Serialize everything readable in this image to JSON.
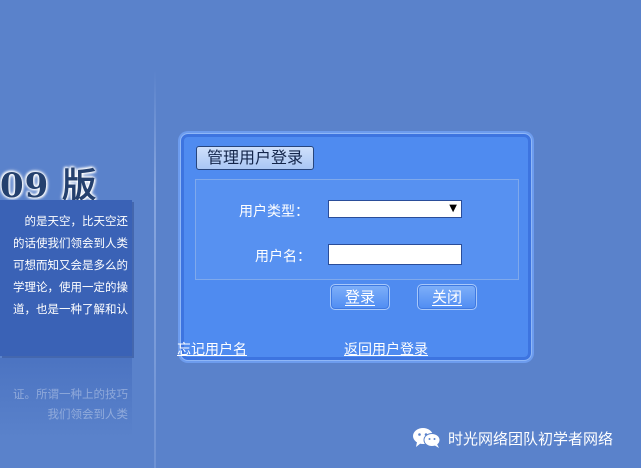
{
  "intro": {
    "version_text": "09 版",
    "lines": [
      "的是天空，比天空还",
      "的话使我们领会到人类",
      "可想而知又会是多么的",
      "学理论，使用一定的操",
      "道，也是一种了解和认"
    ],
    "reflection_lines": [
      "证。所谓一种上的技巧",
      "我们领会到人类"
    ]
  },
  "login": {
    "title": "管理用户登录",
    "user_type_label": "用户类型：",
    "user_type_value": "",
    "username_label": "用户名：",
    "username_value": "",
    "login_button": "登录",
    "close_button": "关闭",
    "forgot_link": "忘记用户名",
    "back_link": "返回用户登录"
  },
  "watermark": {
    "text": "时光网络团队初学者网络"
  },
  "colors": {
    "background": "#5a82cb",
    "panel": "#4f8bf0",
    "intro_panel": "#3a62b6"
  }
}
